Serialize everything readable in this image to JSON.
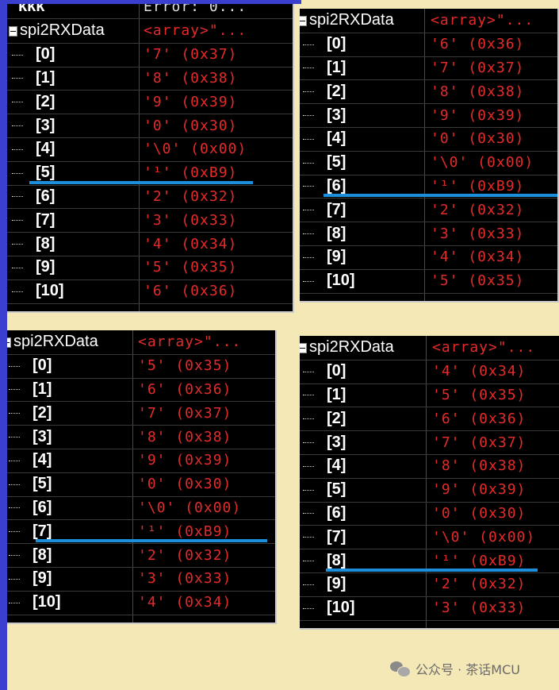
{
  "top_partial": {
    "name": "kkk",
    "value": "Error: 0..."
  },
  "panels": [
    {
      "header": {
        "name": "spi2RXData",
        "value": "<array>\"..."
      },
      "rows": [
        {
          "index": "[0]",
          "value": "'7' (0x37)"
        },
        {
          "index": "[1]",
          "value": "'8' (0x38)"
        },
        {
          "index": "[2]",
          "value": "'9' (0x39)"
        },
        {
          "index": "[3]",
          "value": "'0' (0x30)"
        },
        {
          "index": "[4]",
          "value": "'\\0' (0x00)"
        },
        {
          "index": "[5]",
          "value": "'¹' (0xB9)"
        },
        {
          "index": "[6]",
          "value": "'2' (0x32)"
        },
        {
          "index": "[7]",
          "value": "'3' (0x33)"
        },
        {
          "index": "[8]",
          "value": "'4' (0x34)"
        },
        {
          "index": "[9]",
          "value": "'5' (0x35)"
        },
        {
          "index": "[10]",
          "value": "'6' (0x36)"
        }
      ],
      "highlight_row": 5
    },
    {
      "header": {
        "name": "spi2RXData",
        "value": "<array>\"..."
      },
      "rows": [
        {
          "index": "[0]",
          "value": "'6' (0x36)"
        },
        {
          "index": "[1]",
          "value": "'7' (0x37)"
        },
        {
          "index": "[2]",
          "value": "'8' (0x38)"
        },
        {
          "index": "[3]",
          "value": "'9' (0x39)"
        },
        {
          "index": "[4]",
          "value": "'0' (0x30)"
        },
        {
          "index": "[5]",
          "value": "'\\0' (0x00)"
        },
        {
          "index": "[6]",
          "value": "'¹' (0xB9)"
        },
        {
          "index": "[7]",
          "value": "'2' (0x32)"
        },
        {
          "index": "[8]",
          "value": "'3' (0x33)"
        },
        {
          "index": "[9]",
          "value": "'4' (0x34)"
        },
        {
          "index": "[10]",
          "value": "'5' (0x35)"
        }
      ],
      "highlight_row": 6
    },
    {
      "header": {
        "name": "spi2RXData",
        "value": "<array>\"..."
      },
      "rows": [
        {
          "index": "[0]",
          "value": "'5' (0x35)"
        },
        {
          "index": "[1]",
          "value": "'6' (0x36)"
        },
        {
          "index": "[2]",
          "value": "'7' (0x37)"
        },
        {
          "index": "[3]",
          "value": "'8' (0x38)"
        },
        {
          "index": "[4]",
          "value": "'9' (0x39)"
        },
        {
          "index": "[5]",
          "value": "'0' (0x30)"
        },
        {
          "index": "[6]",
          "value": "'\\0' (0x00)"
        },
        {
          "index": "[7]",
          "value": "'¹' (0xB9)"
        },
        {
          "index": "[8]",
          "value": "'2' (0x32)"
        },
        {
          "index": "[9]",
          "value": "'3' (0x33)"
        },
        {
          "index": "[10]",
          "value": "'4' (0x34)"
        }
      ],
      "highlight_row": 7
    },
    {
      "header": {
        "name": "spi2RXData",
        "value": "<array>\"..."
      },
      "rows": [
        {
          "index": "[0]",
          "value": "'4' (0x34)"
        },
        {
          "index": "[1]",
          "value": "'5' (0x35)"
        },
        {
          "index": "[2]",
          "value": "'6' (0x36)"
        },
        {
          "index": "[3]",
          "value": "'7' (0x37)"
        },
        {
          "index": "[4]",
          "value": "'8' (0x38)"
        },
        {
          "index": "[5]",
          "value": "'9' (0x39)"
        },
        {
          "index": "[6]",
          "value": "'0' (0x30)"
        },
        {
          "index": "[7]",
          "value": "'\\0' (0x00)"
        },
        {
          "index": "[8]",
          "value": "'¹' (0xB9)"
        },
        {
          "index": "[9]",
          "value": "'2' (0x32)"
        },
        {
          "index": "[10]",
          "value": "'3' (0x33)"
        }
      ],
      "highlight_row": 8
    }
  ],
  "watermark": {
    "text": "公众号 · 茶话MCU",
    "icon": "wechat-icon"
  },
  "colors": {
    "value_red": "#e42b2b",
    "highlight_blue": "#1b8fdc",
    "background": "#f5e8b7",
    "frame_blue": "#3b3fd0"
  }
}
